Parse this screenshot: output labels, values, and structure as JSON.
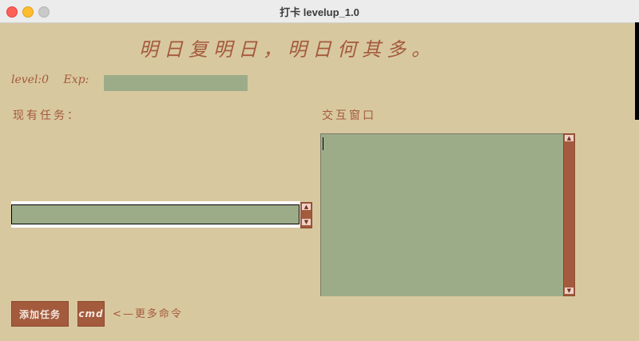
{
  "window": {
    "title": "打卡 levelup_1.0"
  },
  "motto": "明日复明日，明日何其多。",
  "status": {
    "level_text": "level:0",
    "exp_label": "Exp:",
    "exp_value": 0
  },
  "tasks": {
    "label": "现有任务："
  },
  "console": {
    "label": "交互窗口"
  },
  "buttons": {
    "add_task": "添加任务",
    "cmd": "cmd"
  },
  "hint": "<—更多命令",
  "colors": {
    "background": "#d8c8a0",
    "accent": "#a45a3c",
    "field": "#9dac88"
  }
}
